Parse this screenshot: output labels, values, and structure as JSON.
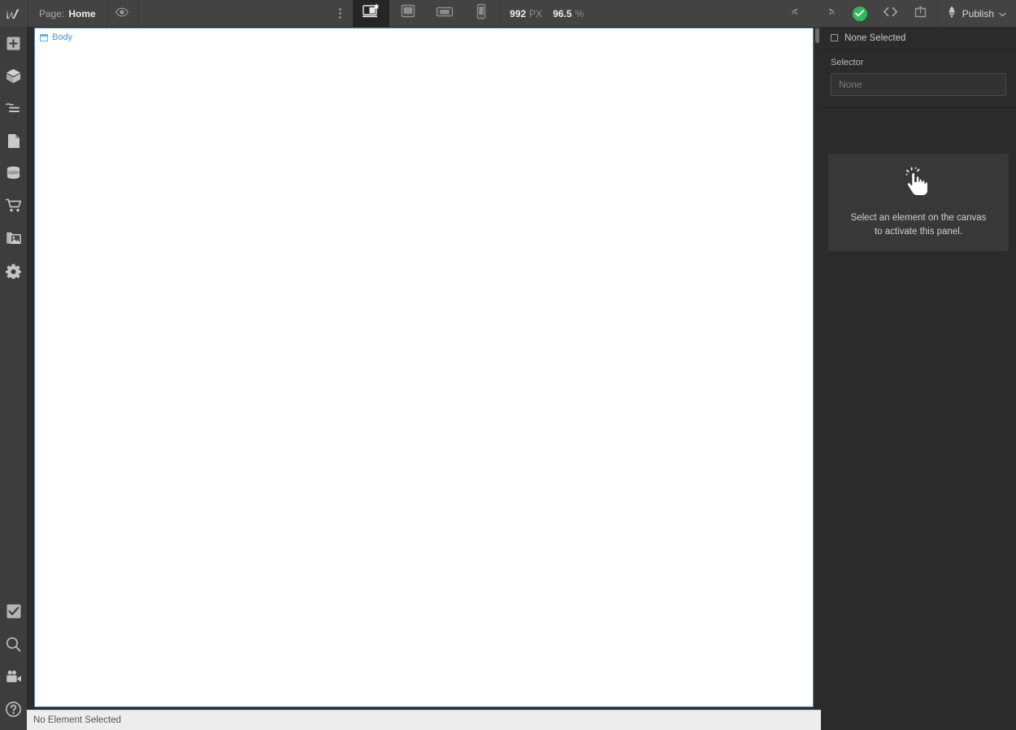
{
  "toolbar": {
    "logo_icon": "webflow-logo-icon",
    "page_label": "Page:",
    "page_name": "Home",
    "preview_icon": "eye-preview-icon",
    "menu_icon": "vertical-dots-menu-icon",
    "breakpoints": [
      {
        "name": "desktop",
        "icon": "desktop-monitor-star-icon",
        "active": true
      },
      {
        "name": "tablet",
        "icon": "tablet-icon",
        "active": false
      },
      {
        "name": "mobile-landscape",
        "icon": "mobile-landscape-icon",
        "active": false
      },
      {
        "name": "mobile-portrait",
        "icon": "mobile-portrait-icon",
        "active": false
      }
    ],
    "viewport_width": "992",
    "viewport_unit": "PX",
    "zoom_value": "96.5",
    "zoom_unit": "%",
    "undo_icon": "undo-arrow-icon",
    "redo_icon": "redo-arrow-icon",
    "saved_icon": "check-saved-icon",
    "saved_color": "#2ebb5c",
    "code_icon": "code-brackets-icon",
    "share_icon": "share-export-icon",
    "publish_icon": "rocket-publish-icon",
    "publish_label": "Publish",
    "publish_caret_icon": "chevron-down-icon"
  },
  "sidebar": {
    "top_items": [
      {
        "name": "add-elements",
        "icon": "plus-square-icon"
      },
      {
        "name": "components",
        "icon": "box-3d-icon"
      },
      {
        "name": "navigator",
        "icon": "navigator-layers-icon"
      },
      {
        "name": "pages",
        "icon": "page-document-icon"
      },
      {
        "name": "cms",
        "icon": "database-stack-icon"
      },
      {
        "name": "ecommerce",
        "icon": "shopping-cart-icon"
      },
      {
        "name": "assets",
        "icon": "image-assets-icon"
      },
      {
        "name": "settings",
        "icon": "gear-icon"
      }
    ],
    "bottom_items": [
      {
        "name": "audit",
        "icon": "checkbox-check-icon"
      },
      {
        "name": "search",
        "icon": "magnifier-search-icon"
      },
      {
        "name": "video-tutorials",
        "icon": "video-camera-icon"
      },
      {
        "name": "help",
        "icon": "question-mark-help-icon"
      }
    ]
  },
  "canvas": {
    "body_label": "Body",
    "body_icon": "body-element-icon",
    "border_color": "#5b89b8"
  },
  "statusbar": {
    "text": "No Element Selected"
  },
  "right_panel": {
    "tabs": [
      {
        "name": "style",
        "icon": "paintbrush-style-icon",
        "active": true
      },
      {
        "name": "settings",
        "icon": "gear-settings-icon",
        "active": false
      },
      {
        "name": "interactions",
        "icon": "water-drops-interactions-icon",
        "active": false
      },
      {
        "name": "effects",
        "icon": "lightning-bolt-icon",
        "active": false
      }
    ],
    "selection_icon": "element-square-icon",
    "selection_label": "None Selected",
    "selector_label": "Selector",
    "selector_placeholder": "None",
    "empty_state": {
      "icon": "pointing-hand-cursor-icon",
      "line1": "Select an element on the canvas",
      "line2": "to activate this panel."
    }
  }
}
